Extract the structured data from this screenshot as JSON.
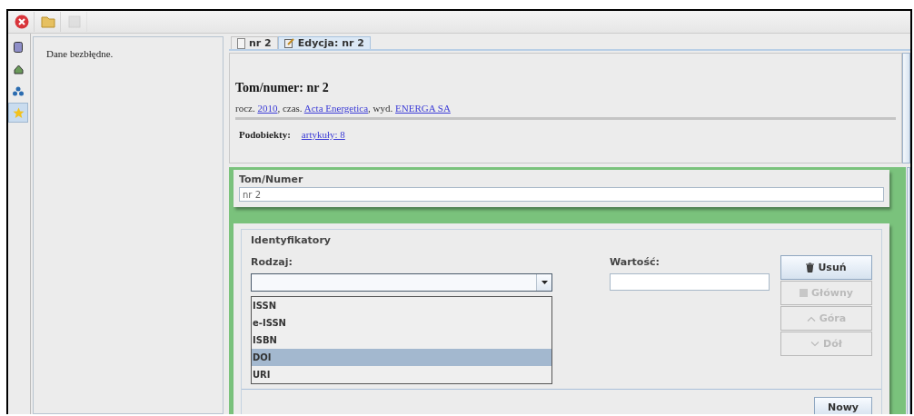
{
  "toolbar": {
    "buttons": [
      {
        "kind": "close",
        "disabled": false
      },
      {
        "kind": "open",
        "disabled": false
      },
      {
        "kind": "blank",
        "disabled": true
      }
    ]
  },
  "sidebar": {
    "items": [
      {
        "kind": "record",
        "selected": false
      },
      {
        "kind": "house",
        "selected": false
      },
      {
        "kind": "tree",
        "selected": false
      },
      {
        "kind": "star",
        "selected": true
      }
    ]
  },
  "messages_panel": {
    "message": "Dane bezbłędne."
  },
  "tabs": [
    {
      "label": "nr 2",
      "kind": "view",
      "selected": false
    },
    {
      "label": "Edycja: nr 2",
      "kind": "edit",
      "selected": true
    }
  ],
  "header": {
    "title": "Tom/numer: nr 2",
    "meta": [
      {
        "text": "rocz. "
      },
      {
        "link": "2010"
      },
      {
        "text": ", czas. "
      },
      {
        "link": "Acta Energetica"
      },
      {
        "text": ", wyd. "
      },
      {
        "link": "ENERGA SA"
      }
    ],
    "subobjects_label": "Podobiekty:",
    "subobjects_link": "artykuły: 8"
  },
  "volume_field": {
    "legend": "Tom/Numer",
    "value": "nr 2"
  },
  "identifiers": {
    "legend": "Identyfikatory",
    "type_label": "Rodzaj:",
    "type_dropdown": {
      "expanded": true,
      "options": [
        {
          "label": "ISSN",
          "selected": false
        },
        {
          "label": "e-ISSN",
          "selected": false
        },
        {
          "label": "ISBN",
          "selected": false
        },
        {
          "label": "DOI",
          "selected": true
        },
        {
          "label": "URI",
          "selected": false
        }
      ]
    },
    "value_label": "Wartość:",
    "buttons": [
      {
        "kind": "delete",
        "label": "Usuń",
        "disabled": false
      },
      {
        "kind": "main",
        "label": "Główny",
        "disabled": true
      },
      {
        "kind": "up",
        "label": "Góra",
        "disabled": true
      },
      {
        "kind": "down",
        "label": "Dół",
        "disabled": true
      }
    ],
    "new_button": "Nowy"
  }
}
